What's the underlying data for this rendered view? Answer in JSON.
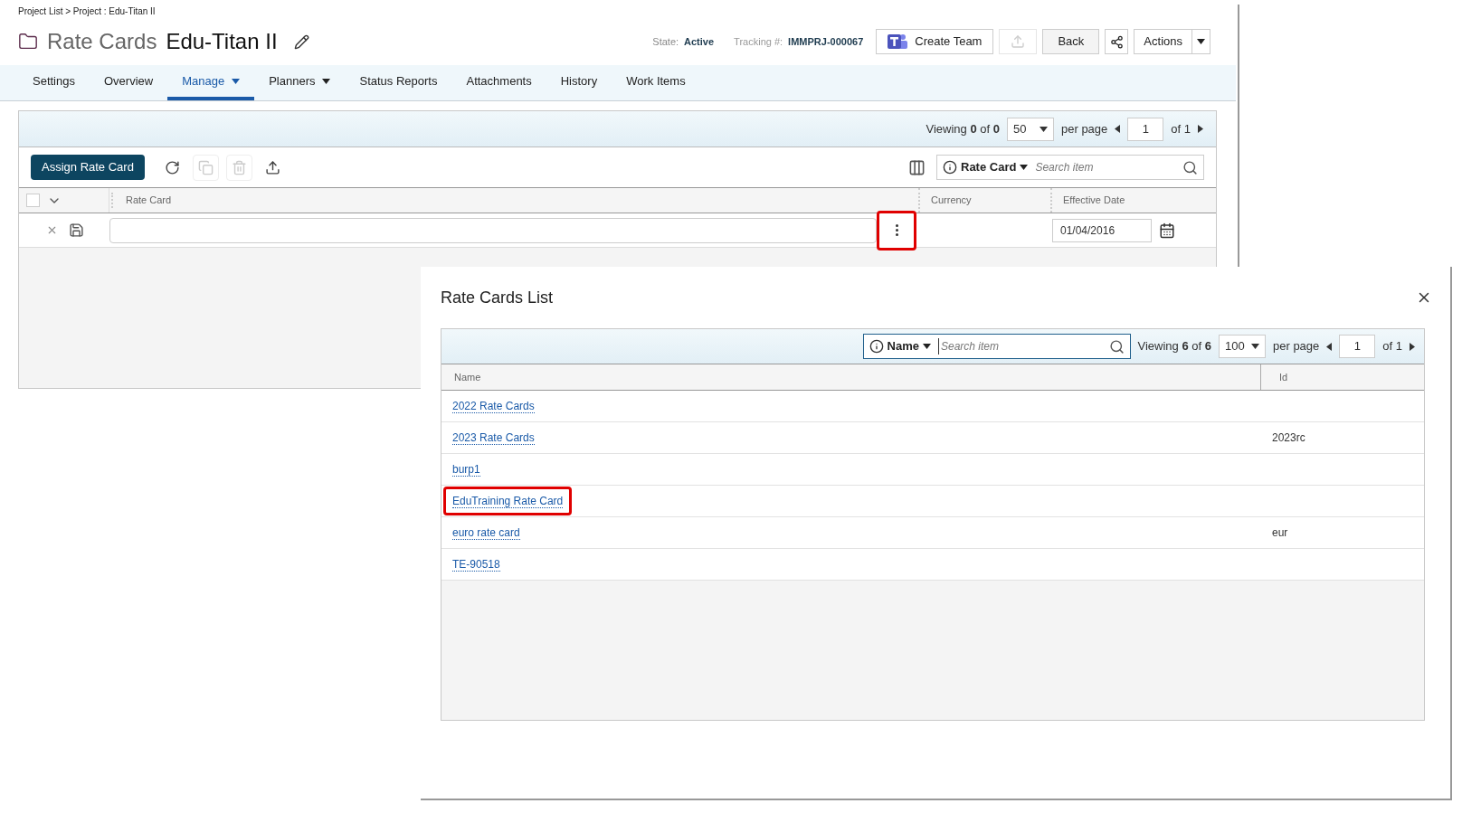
{
  "breadcrumb": "Project List > Project : Edu-Titan II",
  "page_title": "Rate Cards",
  "project_name": "Edu-Titan II",
  "state": {
    "label": "State:",
    "value": "Active"
  },
  "tracking": {
    "label": "Tracking #:",
    "value": "IMMPRJ-000067"
  },
  "header_buttons": [
    {
      "kind": "teams",
      "label": "Create Team",
      "disabled": false
    },
    {
      "kind": "export",
      "disabled": true
    },
    {
      "kind": "text",
      "label": "Back",
      "disabled": false
    },
    {
      "kind": "share",
      "disabled": false
    },
    {
      "kind": "split",
      "label": "Actions",
      "disabled": false
    }
  ],
  "tabs": [
    {
      "label": "Settings",
      "selected": false,
      "dropdown": false
    },
    {
      "label": "Overview",
      "selected": false,
      "dropdown": false
    },
    {
      "label": "Manage",
      "selected": true,
      "dropdown": true
    },
    {
      "label": "Planners",
      "selected": false,
      "dropdown": true
    },
    {
      "label": "Status Reports",
      "selected": false,
      "dropdown": false
    },
    {
      "label": "Attachments",
      "selected": false,
      "dropdown": false
    },
    {
      "label": "History",
      "selected": false,
      "dropdown": false
    },
    {
      "label": "Work Items",
      "selected": false,
      "dropdown": false
    }
  ],
  "grid": {
    "pager": {
      "viewing": "Viewing **0** of **0**",
      "page_size": "50",
      "per_page": "per page",
      "page": "1",
      "of_pages": "of 1"
    },
    "assign_button": "Assign Rate Card",
    "select_all_checked": false,
    "tools": [
      {
        "kind": "refresh",
        "disabled": false
      },
      {
        "kind": "copy",
        "disabled": true
      },
      {
        "kind": "delete",
        "disabled": true
      },
      {
        "kind": "export",
        "disabled": false
      }
    ],
    "search": {
      "field": "Rate Card",
      "placeholder": "Search item"
    },
    "columns": [
      "Rate Card",
      "Currency",
      "Effective Date"
    ],
    "edit_row": {
      "effective_date": "01/04/2016",
      "picker_highlighted": true
    }
  },
  "dialog": {
    "title": "Rate Cards List",
    "search": {
      "field": "Name",
      "placeholder": "Search item"
    },
    "pager": {
      "viewing": "Viewing **6** of **6**",
      "page_size": "100",
      "per_page": "per page",
      "page": "1",
      "of_pages": "of 1"
    },
    "columns": [
      "Name",
      "Id"
    ],
    "rows": [
      {
        "name": "2022 Rate Cards",
        "highlighted": false
      },
      {
        "name": "2023 Rate Cards",
        "id": "2023rc",
        "highlighted": false
      },
      {
        "name": "burp1",
        "highlighted": false
      },
      {
        "name": "EduTraining Rate Card",
        "highlighted": true
      },
      {
        "name": "euro rate card",
        "id": "eur",
        "highlighted": false
      },
      {
        "name": "TE-90518",
        "highlighted": false
      }
    ]
  }
}
